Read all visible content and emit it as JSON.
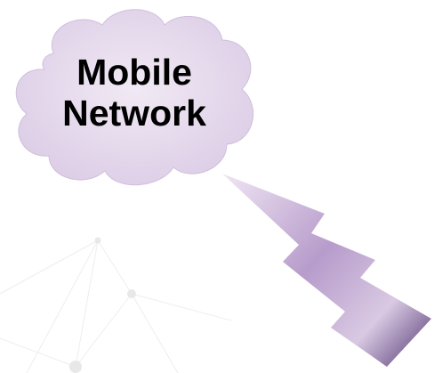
{
  "cloud": {
    "line1": "Mobile",
    "line2": "Network",
    "fill_color": "#e6d9ec"
  },
  "bolt": {
    "color_light": "#e8dcef",
    "color_mid": "#a98bbd",
    "color_dark": "#5a3d78"
  },
  "background": {
    "network_line_color": "#eeeeee"
  }
}
